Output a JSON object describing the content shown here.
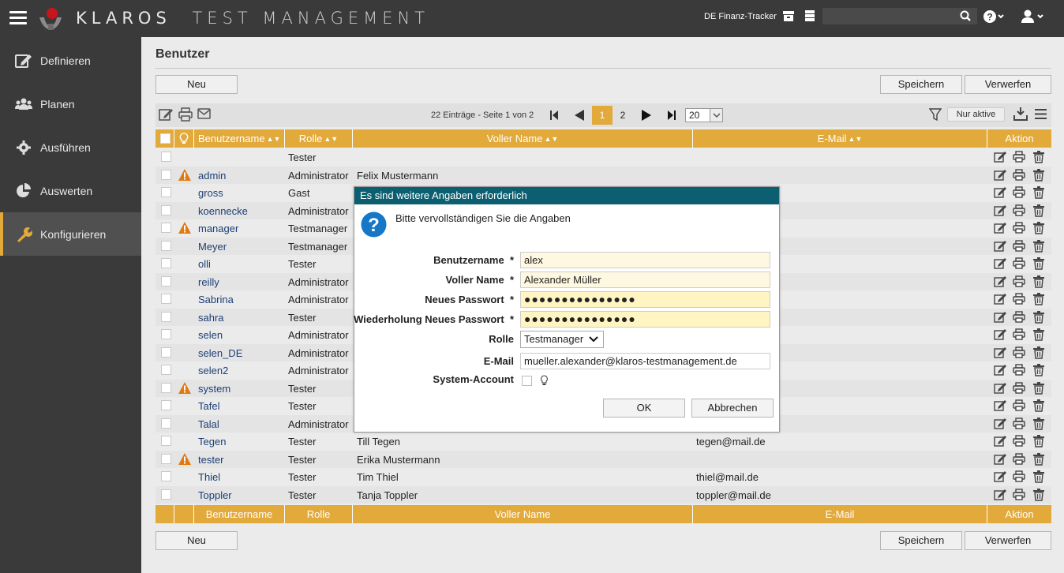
{
  "app": {
    "brand_left": "KLAROS",
    "brand_right": "TEST MANAGEMENT",
    "project": "DE Finanz-Tracker",
    "search_value": ""
  },
  "sidebar": {
    "items": [
      {
        "label": "Definieren",
        "icon": "edit-icon"
      },
      {
        "label": "Planen",
        "icon": "users-icon"
      },
      {
        "label": "Ausführen",
        "icon": "gear-icon"
      },
      {
        "label": "Auswerten",
        "icon": "pie-chart-icon"
      },
      {
        "label": "Konfigurieren",
        "icon": "wrench-icon",
        "active": true
      }
    ]
  },
  "page": {
    "title": "Benutzer",
    "new_label": "Neu",
    "save_label": "Speichern",
    "discard_label": "Verwerfen"
  },
  "pager": {
    "info": "22 Einträge - Seite 1 von 2",
    "pages": [
      "1",
      "2"
    ],
    "current_page": "1",
    "page_size": "20",
    "filter_label": "Nur aktive"
  },
  "table": {
    "headers": {
      "username": "Benutzername",
      "role": "Rolle",
      "fullname": "Voller Name",
      "email": "E-Mail",
      "action": "Aktion"
    },
    "rows": [
      {
        "username": "",
        "role": "Tester",
        "fullname": "",
        "email": "",
        "warn": false
      },
      {
        "username": "admin",
        "role": "Administrator",
        "fullname": "Felix Mustermann",
        "email": "",
        "warn": true
      },
      {
        "username": "gross",
        "role": "Gast",
        "fullname": "",
        "email": "",
        "warn": false
      },
      {
        "username": "koennecke",
        "role": "Administrator",
        "fullname": "",
        "email": "",
        "warn": false
      },
      {
        "username": "manager",
        "role": "Testmanager",
        "fullname": "",
        "email": "",
        "warn": true
      },
      {
        "username": "Meyer",
        "role": "Testmanager",
        "fullname": "",
        "email": "",
        "warn": false
      },
      {
        "username": "olli",
        "role": "Tester",
        "fullname": "",
        "email": "",
        "warn": false
      },
      {
        "username": "reilly",
        "role": "Administrator",
        "fullname": "",
        "email": "",
        "warn": false
      },
      {
        "username": "Sabrina",
        "role": "Administrator",
        "fullname": "",
        "email": "",
        "warn": false
      },
      {
        "username": "sahra",
        "role": "Tester",
        "fullname": "",
        "email": "",
        "warn": false
      },
      {
        "username": "selen",
        "role": "Administrator",
        "fullname": "",
        "email": "",
        "warn": false
      },
      {
        "username": "selen_DE",
        "role": "Administrator",
        "fullname": "",
        "email": "",
        "warn": false
      },
      {
        "username": "selen2",
        "role": "Administrator",
        "fullname": "",
        "email": "",
        "warn": false
      },
      {
        "username": "system",
        "role": "Tester",
        "fullname": "",
        "email": "",
        "warn": true
      },
      {
        "username": "Tafel",
        "role": "Tester",
        "fullname": "",
        "email": "",
        "warn": false
      },
      {
        "username": "Talal",
        "role": "Administrator",
        "fullname": "",
        "email": "",
        "warn": false
      },
      {
        "username": "Tegen",
        "role": "Tester",
        "fullname": "Till Tegen",
        "email": "tegen@mail.de",
        "warn": false
      },
      {
        "username": "tester",
        "role": "Tester",
        "fullname": "Erika Mustermann",
        "email": "",
        "warn": true
      },
      {
        "username": "Thiel",
        "role": "Tester",
        "fullname": "Tim Thiel",
        "email": "thiel@mail.de",
        "warn": false
      },
      {
        "username": "Toppler",
        "role": "Tester",
        "fullname": "Tanja Toppler",
        "email": "toppler@mail.de",
        "warn": false
      }
    ]
  },
  "dialog": {
    "title": "Es sind weitere Angaben erforderlich",
    "message": "Bitte vervollständigen Sie die Angaben",
    "fields": {
      "username_label": "Benutzername",
      "username_value": "alex",
      "fullname_label": "Voller Name",
      "fullname_value": "Alexander Müller",
      "password_label": "Neues Passwort",
      "password_value": "●●●●●●●●●●●●●●●",
      "password_repeat_label": "Wiederholung Neues Passwort",
      "password_repeat_value": "●●●●●●●●●●●●●●●",
      "role_label": "Rolle",
      "role_value": "Testmanager",
      "email_label": "E-Mail",
      "email_value": "mueller.alexander@klaros-testmanagement.de",
      "system_label": "System-Account",
      "required_mark": "*"
    },
    "ok_label": "OK",
    "cancel_label": "Abbrechen"
  },
  "colors": {
    "accent": "#e2a93b",
    "dialog_header": "#0b5f70",
    "sidebar": "#3a3a3a"
  }
}
